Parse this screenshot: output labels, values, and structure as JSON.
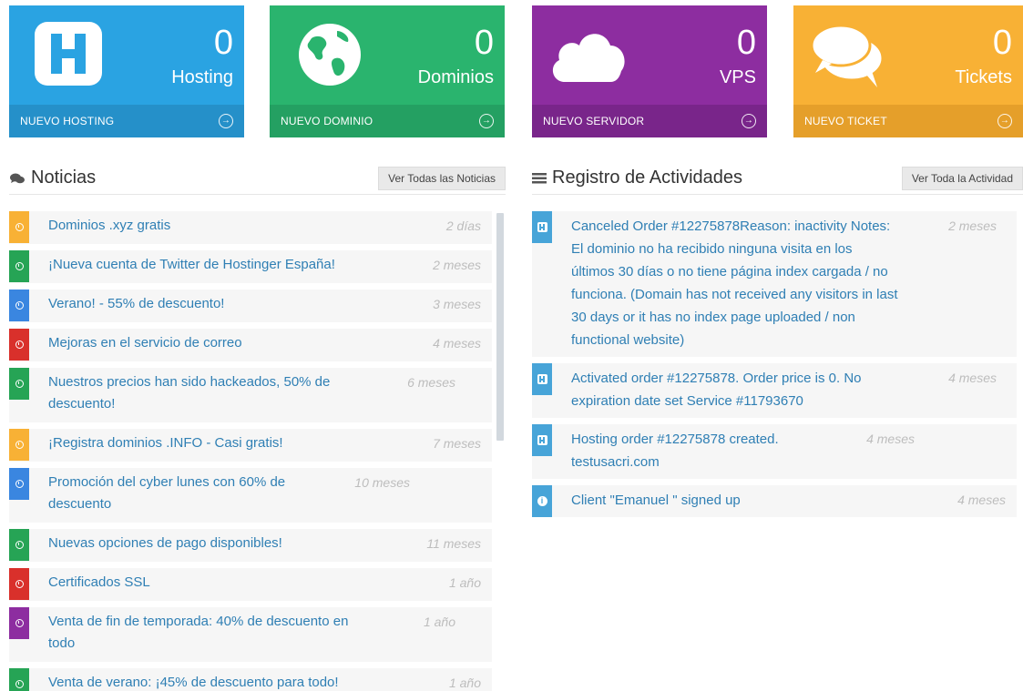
{
  "tiles": [
    {
      "count": "0",
      "label": "Hosting",
      "footer": "NUEVO HOSTING",
      "icon": "hosting-h-icon",
      "color": "#2aa3e2"
    },
    {
      "count": "0",
      "label": "Dominios",
      "footer": "NUEVO DOMINIO",
      "icon": "globe-icon",
      "color": "#2ab46e"
    },
    {
      "count": "0",
      "label": "VPS",
      "footer": "NUEVO SERVIDOR",
      "icon": "cloud-icon",
      "color": "#8d2da0"
    },
    {
      "count": "0",
      "label": "Tickets",
      "footer": "NUEVO TICKET",
      "icon": "chat-bubbles-icon",
      "color": "#f8b135"
    }
  ],
  "news": {
    "title": "Noticias",
    "icon": "comments-icon",
    "view_all": "Ver Todas las Noticias",
    "items": [
      {
        "text": "Dominios .xyz gratis",
        "time": "2 días",
        "color": "orange"
      },
      {
        "text": "¡Nueva cuenta de Twitter de Hostinger España!",
        "time": "2 meses",
        "color": "green"
      },
      {
        "text": "Verano! - 55% de descuento!",
        "time": "3 meses",
        "color": "blue"
      },
      {
        "text": "Mejoras en el servicio de correo",
        "time": "4 meses",
        "color": "red"
      },
      {
        "text": "Nuestros precios han sido hackeados, 50% de descuento!",
        "time": "6 meses",
        "color": "green"
      },
      {
        "text": "¡Registra dominios .INFO - Casi gratis!",
        "time": "7 meses",
        "color": "orange"
      },
      {
        "text": "Promoción del cyber lunes con 60% de descuento",
        "time": "10 meses",
        "color": "blue"
      },
      {
        "text": "Nuevas opciones de pago disponibles!",
        "time": "11 meses",
        "color": "green"
      },
      {
        "text": "Certificados SSL",
        "time": "1 año",
        "color": "red"
      },
      {
        "text": "Venta de fin de temporada: 40% de descuento en todo",
        "time": "1 año",
        "color": "purple"
      },
      {
        "text": "Venta de verano: ¡45% de descuento para todo!",
        "time": "1 año",
        "color": "green"
      }
    ]
  },
  "activity": {
    "title": "Registro de Actividades",
    "icon": "list-icon",
    "view_all": "Ver Toda la Actividad",
    "items": [
      {
        "text": "Canceled Order #12275878Reason: inactivity Notes: El dominio no ha recibido ninguna visita en los últimos 30 días o no tiene página index cargada / no funciona. (Domain has not received any visitors in last 30 days or it has no index page uploaded / non functional website)",
        "time": "2 meses",
        "icon": "hosting-h-icon"
      },
      {
        "text": "Activated order #12275878. Order price is 0. No expiration date set Service #11793670",
        "time": "4 meses",
        "icon": "hosting-h-icon"
      },
      {
        "text": "Hosting order #12275878 created. testusacri.com",
        "time": "4 meses",
        "icon": "hosting-h-icon"
      },
      {
        "text": "Client \"Emanuel \" signed up",
        "time": "4 meses",
        "icon": "info-icon"
      }
    ]
  }
}
